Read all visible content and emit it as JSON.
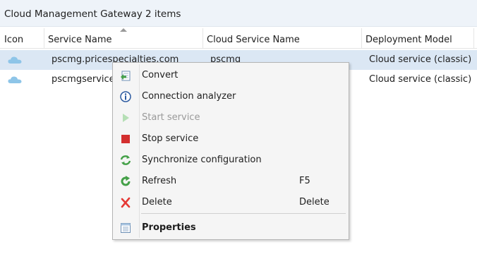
{
  "header": {
    "title": "Cloud Management Gateway 2 items"
  },
  "columns": [
    {
      "label": "Icon"
    },
    {
      "label": "Service Name"
    },
    {
      "label": "Cloud Service Name"
    },
    {
      "label": "Deployment Model"
    }
  ],
  "rows": [
    {
      "icon": "cloud-icon",
      "service_name": "pscmg.pricespecialties.com",
      "cloud_service_name": "pscmg",
      "deployment_model": "Cloud service (classic)",
      "selected": true
    },
    {
      "icon": "cloud-icon",
      "service_name": "pscmgservice",
      "cloud_service_name": "",
      "deployment_model": "Cloud service (classic)",
      "selected": false
    }
  ],
  "context_menu": {
    "items": [
      {
        "label": "Convert",
        "shortcut": "",
        "icon": "convert-icon",
        "disabled": false
      },
      {
        "label": "Connection analyzer",
        "shortcut": "",
        "icon": "info-icon",
        "disabled": false
      },
      {
        "label": "Start service",
        "shortcut": "",
        "icon": "play-icon",
        "disabled": true
      },
      {
        "label": "Stop service",
        "shortcut": "",
        "icon": "stop-icon",
        "disabled": false
      },
      {
        "label": "Synchronize configuration",
        "shortcut": "",
        "icon": "sync-icon",
        "disabled": false
      },
      {
        "label": "Refresh",
        "shortcut": "F5",
        "icon": "refresh-icon",
        "disabled": false
      },
      {
        "label": "Delete",
        "shortcut": "Delete",
        "icon": "delete-icon",
        "disabled": false
      },
      {
        "label": "Properties",
        "shortcut": "",
        "icon": "properties-icon",
        "disabled": false,
        "bold": true
      }
    ]
  },
  "colors": {
    "header_bg": "#eef3f9",
    "selected_row": "#dbe7f4",
    "menu_bg": "#f5f5f5",
    "stop_red": "#d32f2f",
    "delete_red": "#e53935",
    "sync_green": "#43a047",
    "info_blue": "#2c5aa0",
    "cloud_blue": "#8ec5e8"
  }
}
